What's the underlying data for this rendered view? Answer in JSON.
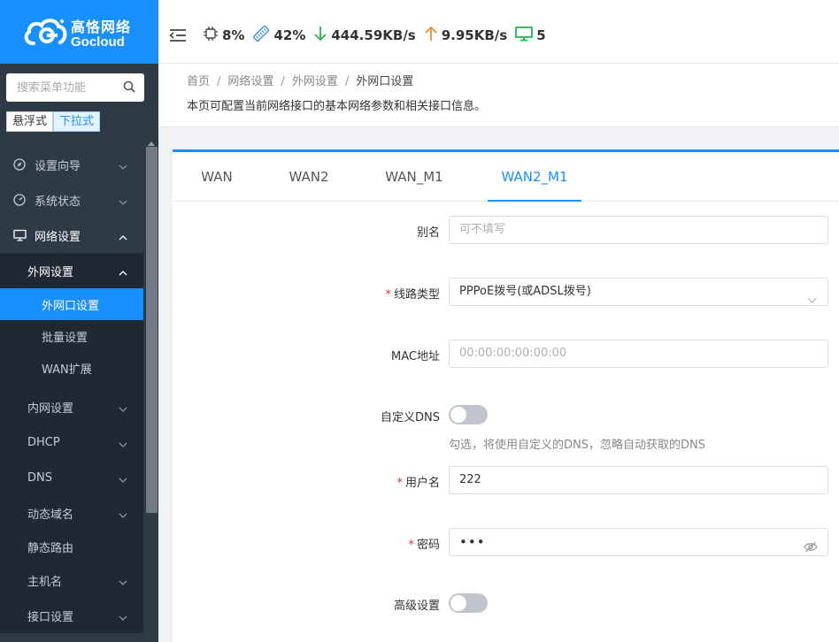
{
  "brand": {
    "name_cn": "高恪网络",
    "name_en": "Gocloud",
    "color": "#1890ff"
  },
  "sidebar": {
    "search_placeholder": "搜索菜单功能",
    "modes": [
      "悬浮式",
      "下拉式"
    ],
    "active_mode": "下拉式",
    "items": [
      {
        "label": "设置向导",
        "icon": "compass-icon"
      },
      {
        "label": "系统状态",
        "icon": "dashboard-icon"
      },
      {
        "label": "网络设置",
        "icon": "monitor-icon"
      },
      {
        "label": "外网设置"
      },
      {
        "label": "外网口设置"
      },
      {
        "label": "批量设置"
      },
      {
        "label": "WAN扩展"
      },
      {
        "label": "内网设置"
      },
      {
        "label": "DHCP"
      },
      {
        "label": "DNS"
      },
      {
        "label": "动态域名"
      },
      {
        "label": "静态路由"
      },
      {
        "label": "主机名"
      },
      {
        "label": "接口设置"
      }
    ]
  },
  "header": {
    "cpu": "8%",
    "memory": "42%",
    "download": "444.59KB/s",
    "upload": "9.95KB/s",
    "clients": "5"
  },
  "breadcrumb": [
    "首页",
    "网络设置",
    "外网设置",
    "外网口设置"
  ],
  "page_desc": "本页可配置当前网络接口的基本网络参数和相关接口信息。",
  "tabs": [
    "WAN",
    "WAN2",
    "WAN_M1",
    "WAN2_M1"
  ],
  "active_tab": "WAN2_M1",
  "form": {
    "alias_label": "别名",
    "alias_placeholder": "可不填写",
    "line_type_label": "线路类型",
    "line_type_value": "PPPoE拨号(或ADSL拨号)",
    "mac_label": "MAC地址",
    "mac_placeholder": "00:00:00:00:00:00",
    "custom_dns_label": "自定义DNS",
    "custom_dns_enabled": false,
    "custom_dns_hint": "勾选，将使用自定义的DNS，忽略自动获取的DNS",
    "username_label": "用户名",
    "username_value": "222",
    "password_label": "密码",
    "password_value": "•••",
    "advanced_label": "高级设置",
    "advanced_enabled": false
  },
  "colors": {
    "accent": "#1890ff",
    "sidebar_bg": "#2f3a47",
    "submenu_bg": "#1f2833",
    "required": "#e03030"
  }
}
